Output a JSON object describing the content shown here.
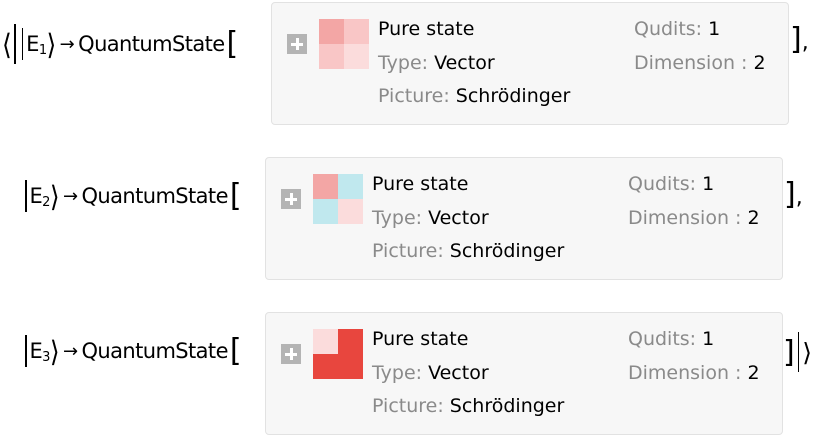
{
  "list_open": "⟨",
  "list_close": "⟩",
  "arrow": "→",
  "head": "QuantumState",
  "open_bracket": "[",
  "close_bracket": "]",
  "comma": ",",
  "rows": [
    {
      "ket_label": "E",
      "ket_index": "1",
      "summary": {
        "title": "Pure state",
        "type_key": "Type:",
        "type_val": "Vector",
        "picture_key": "Picture:",
        "picture_val": "Schrödinger",
        "qudits_key": "Qudits:",
        "qudits_val": "1",
        "dim_key": "Dimension :",
        "dim_val": "2",
        "matrix_colors": [
          "#f3a6a5",
          "#f9c6c6",
          "#f9c6c6",
          "#fbdcdc"
        ]
      }
    },
    {
      "ket_label": "E",
      "ket_index": "2",
      "summary": {
        "title": "Pure state",
        "type_key": "Type:",
        "type_val": "Vector",
        "picture_key": "Picture:",
        "picture_val": "Schrödinger",
        "qudits_key": "Qudits:",
        "qudits_val": "1",
        "dim_key": "Dimension :",
        "dim_val": "2",
        "matrix_colors": [
          "#f3a6a5",
          "#c0e8ee",
          "#c0e8ee",
          "#fbdcdc"
        ]
      }
    },
    {
      "ket_label": "E",
      "ket_index": "3",
      "summary": {
        "title": "Pure state",
        "type_key": "Type:",
        "type_val": "Vector",
        "picture_key": "Picture:",
        "picture_val": "Schrödinger",
        "qudits_key": "Qudits:",
        "qudits_val": "1",
        "dim_key": "Dimension :",
        "dim_val": "2",
        "matrix_colors": [
          "#fbdcdc",
          "#e8463e",
          "#e8463e",
          "#e8463e"
        ]
      }
    }
  ]
}
